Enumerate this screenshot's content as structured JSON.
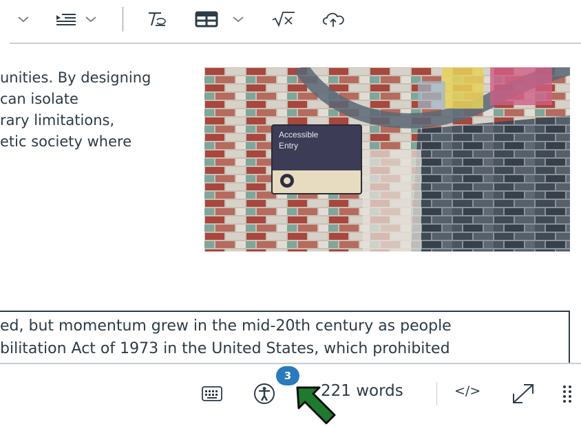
{
  "toolbar": {
    "icons": [
      "chevron-down-icon",
      "list-indent-icon",
      "chevron-down-icon",
      "clear-formatting-icon",
      "table-icon",
      "chevron-down-icon",
      "math-equation-icon",
      "cloud-upload-icon"
    ]
  },
  "content": {
    "paragraph_top": [
      "unities. By designing",
      " can isolate",
      "rary limitations,",
      "etic society where"
    ],
    "image_sign": {
      "line1": "Accessible",
      "line2": "Entry"
    },
    "paragraph_bottom": [
      "ed, but momentum grew in the mid-20th century as people",
      "bilitation Act of 1973 in the United States, which prohibited"
    ]
  },
  "statusbar": {
    "accessibility_badge": "3",
    "word_count": "221 words",
    "html_toggle": "</>",
    "icons": [
      "keyboard-icon",
      "accessibility-icon",
      "fullscreen-icon",
      "drag-handle-icon"
    ]
  },
  "colors": {
    "text": "#2d3b45",
    "badge": "#2b7abc",
    "annotation_arrow": "#1e7a2e",
    "rule": "#c7cdd1"
  }
}
